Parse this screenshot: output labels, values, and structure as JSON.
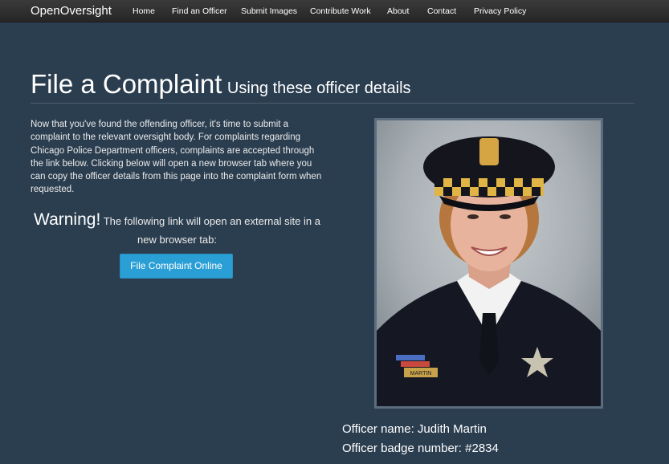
{
  "navbar": {
    "brand": "OpenOversight",
    "links": [
      "Home",
      "Find an Officer",
      "Submit Images",
      "Contribute Work",
      "About",
      "Contact",
      "Privacy Policy"
    ]
  },
  "page": {
    "title": "File a Complaint",
    "subtitle": "Using these officer details",
    "intro": "Now that you've found the offending officer, it's time to submit a complaint to the relevant oversight body. For complaints regarding Chicago Police Department officers, complaints are accepted through the link below. Clicking below will open a new browser tab where you can copy the officer details from this page into the complaint form when requested.",
    "warning_label": "Warning!",
    "warning_text": "The following link will open an external site in a new browser tab:",
    "button_label": "File Complaint Online"
  },
  "officer": {
    "name_line": "Officer name: Judith Martin",
    "badge_line": "Officer badge number: #2834",
    "nameplate": "MARTIN"
  },
  "colors": {
    "background": "#2b3e50",
    "navbar": "#262626",
    "button": "#2a9fd6",
    "rule": "#4e5d6c"
  }
}
